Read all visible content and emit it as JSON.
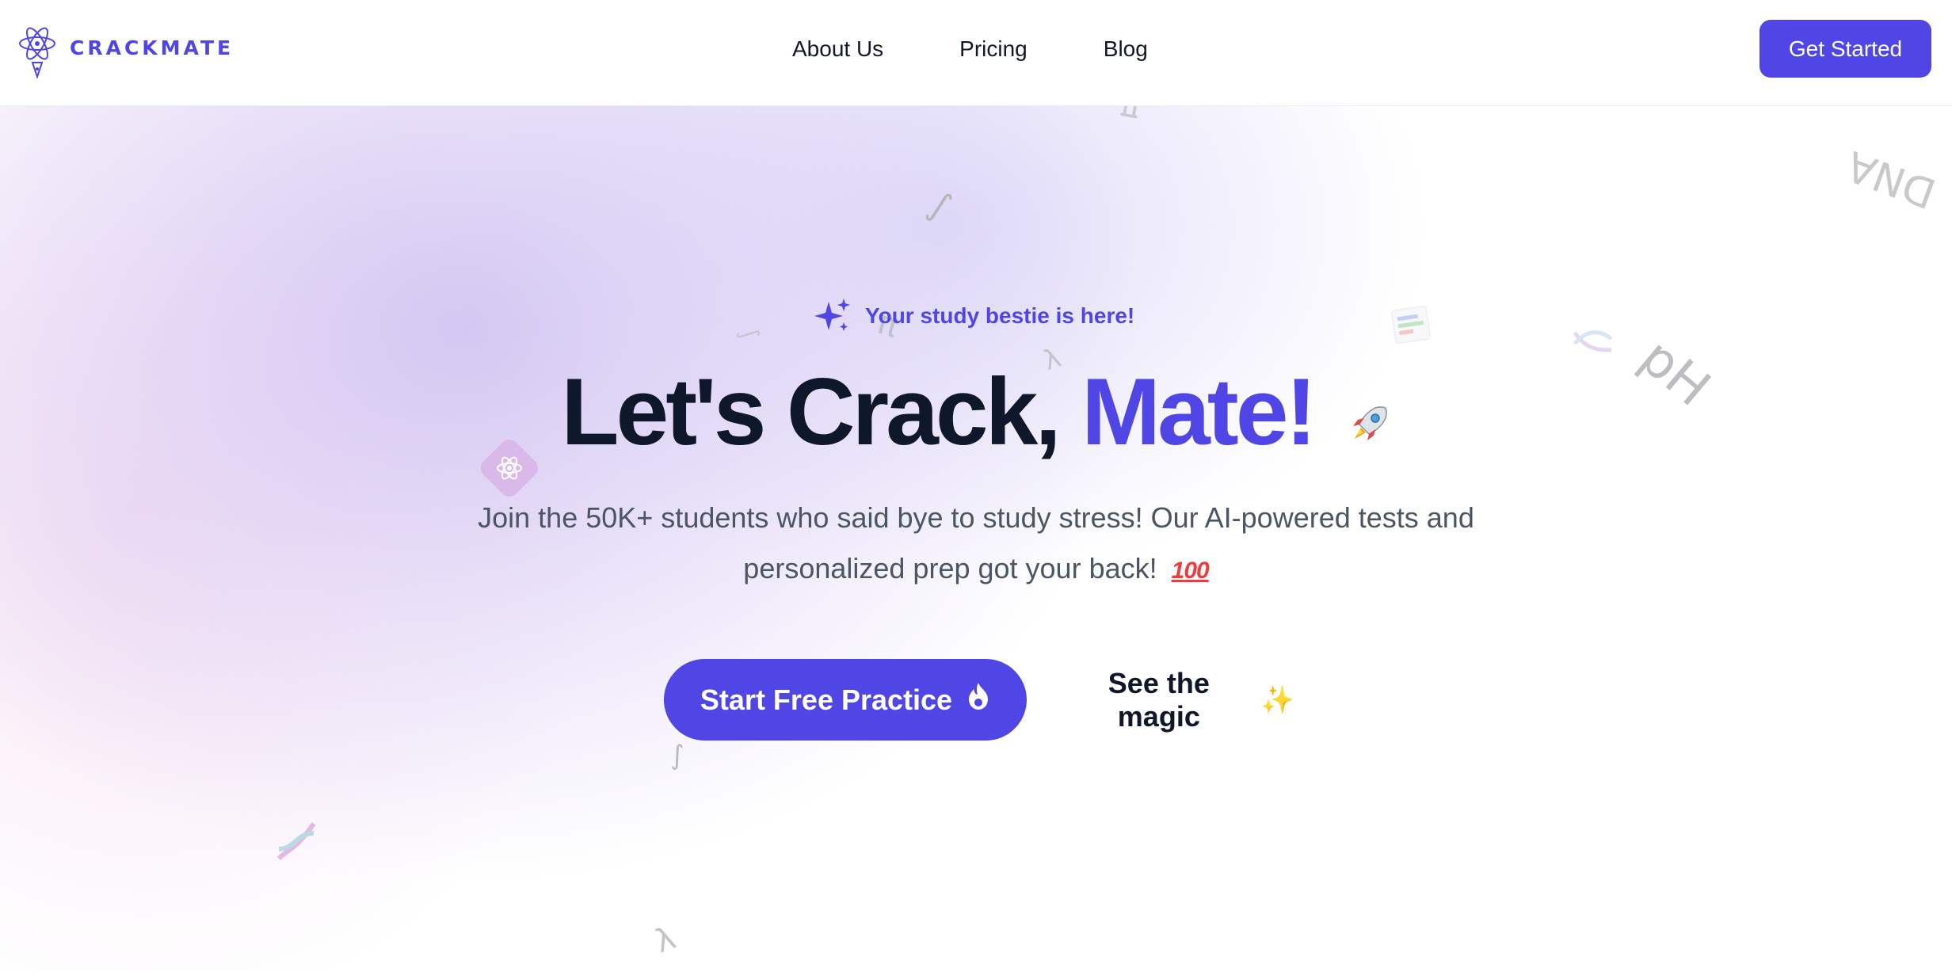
{
  "brand": {
    "name": "CRACKMATE",
    "accent": "#4f46e5"
  },
  "nav": {
    "items": [
      {
        "label": "About Us"
      },
      {
        "label": "Pricing"
      },
      {
        "label": "Blog"
      }
    ],
    "cta_label": "Get Started"
  },
  "hero": {
    "tagline": "Your study bestie is here!",
    "headline_main": "Let's Crack,",
    "headline_accent": "Mate!",
    "subtitle_line1": "Join the 50K+ students who said bye to study stress! Our AI-powered tests and",
    "subtitle_line2": "personalized prep got your back!",
    "subtitle_emoji": "100",
    "primary_button": "Start Free Practice",
    "secondary_button": "See the magic"
  },
  "decorations": {
    "dna": "DNA",
    "ph": "pH",
    "pi": "π",
    "lambda": "λ",
    "integral": "∫"
  },
  "icons": {
    "logo": "atom-pen-logo",
    "tagline": "sparkles-icon",
    "rocket": "rocket-icon",
    "fire": "fire-icon",
    "sparkle": "sparkle-icon"
  }
}
